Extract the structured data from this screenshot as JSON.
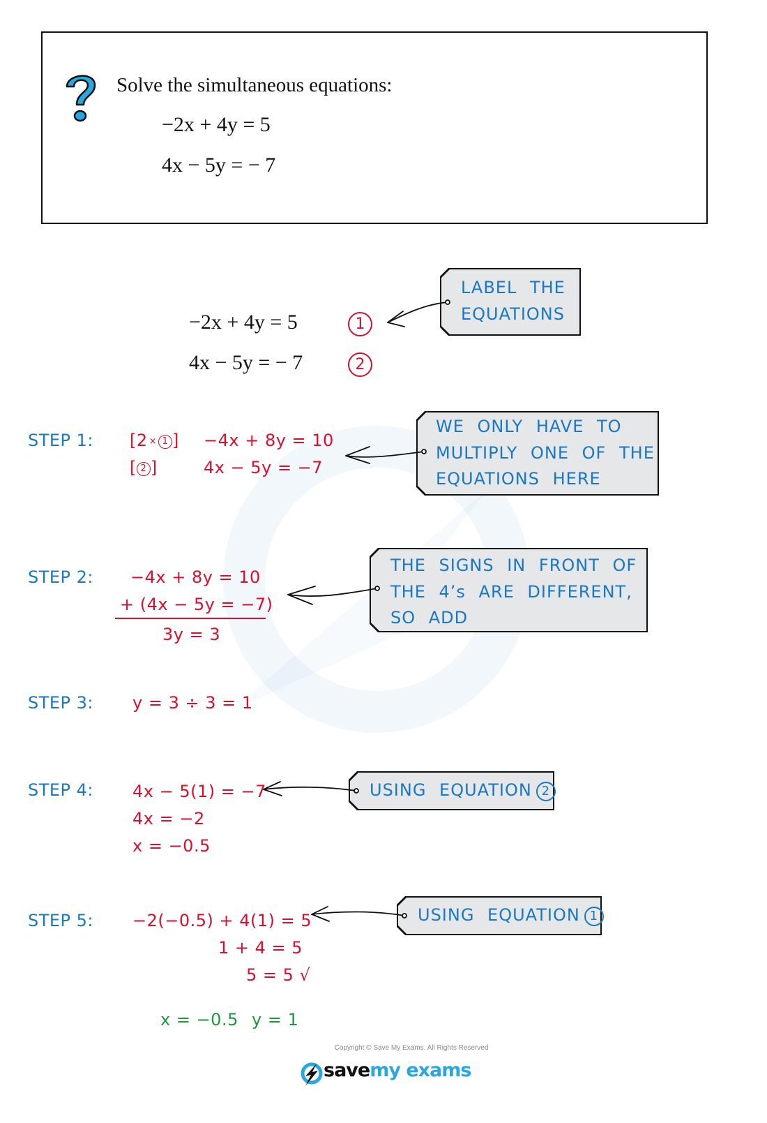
{
  "question": {
    "icon": "question-mark-icon",
    "prompt": "Solve the simultaneous equations:",
    "equations": [
      {
        "lhs": "−2x + 4y = 5"
      },
      {
        "lhs": "4x − 5y = − 7"
      }
    ]
  },
  "labelled_equations": [
    {
      "text": "−2x + 4y = 5",
      "label": "1"
    },
    {
      "text": "4x − 5y = − 7",
      "label": "2"
    }
  ],
  "notes": {
    "label": [
      "LABEL THE",
      "EQUATIONS"
    ],
    "multiply": [
      "WE ONLY HAVE TO",
      "MULTIPLY ONE OF THE",
      "EQUATIONS HERE"
    ],
    "signs": [
      "THE SIGNS IN FRONT OF",
      "THE 4’s ARE DIFFERENT,",
      "SO ADD"
    ],
    "using2": {
      "text": "USING EQUATION",
      "num": "2"
    },
    "using1": {
      "text": "USING EQUATION",
      "num": "1"
    }
  },
  "steps": [
    {
      "label": "STEP 1:",
      "lines": [
        {
          "prefix_open": "[2",
          "prefix_times": "×",
          "prefix_num": "1",
          "prefix_close": "]",
          "eq": "−4x + 8y = 10"
        },
        {
          "prefix_open": "[",
          "prefix_num": "2",
          "prefix_close": "]",
          "eq": "4x − 5y = −7"
        }
      ]
    },
    {
      "label": "STEP 2:",
      "lines": [
        "−4x + 8y = 10",
        "+ (4x − 5y = −7)",
        "3y = 3"
      ]
    },
    {
      "label": "STEP 3:",
      "lines": [
        "y = 3 ÷ 3 = 1"
      ]
    },
    {
      "label": "STEP 4:",
      "lines": [
        "4x − 5(1) = −7",
        "4x = −2",
        "x = −0.5"
      ]
    },
    {
      "label": "STEP 5:",
      "lines": [
        "−2(−0.5) + 4(1) = 5",
        "1 + 4 = 5",
        "5 = 5 √"
      ]
    }
  ],
  "answer": {
    "x": "x = −0.5",
    "y": "y = 1"
  },
  "footer": {
    "copyright": "Copyright © Save My Exams. All Rights Reserved",
    "brand_part1": "save",
    "brand_part2": "my exams",
    "logo_icon": "lightning-bolt-logo-icon"
  },
  "colors": {
    "step_blue": "#1a78c2",
    "working_red": "#d7102d",
    "answer_green": "#1a9a3a",
    "note_bg": "#e6e7e8",
    "brand_blue": "#29a8e0"
  }
}
